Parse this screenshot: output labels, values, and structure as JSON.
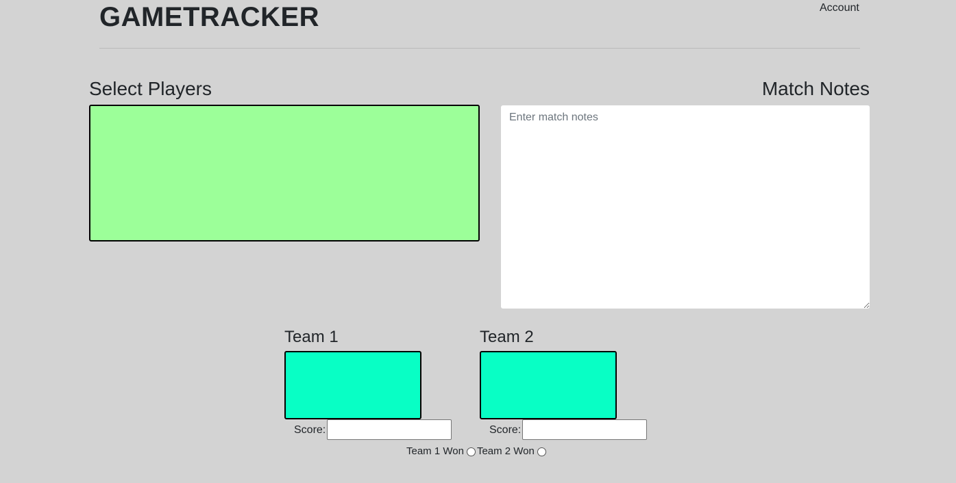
{
  "header": {
    "brand": "GAMETRACKER",
    "account_label": "Account"
  },
  "players": {
    "title": "Select Players"
  },
  "notes": {
    "title": "Match Notes",
    "placeholder": "Enter match notes",
    "value": ""
  },
  "teams": [
    {
      "title": "Team 1",
      "score_label": "Score:",
      "score_value": "",
      "won_label": "Team 1 Won"
    },
    {
      "title": "Team 2",
      "score_label": "Score:",
      "score_value": "",
      "won_label": "Team 2 Won"
    }
  ],
  "colors": {
    "background": "#d3d3d3",
    "players_box": "#9cff99",
    "team_box": "#08ffc5"
  }
}
